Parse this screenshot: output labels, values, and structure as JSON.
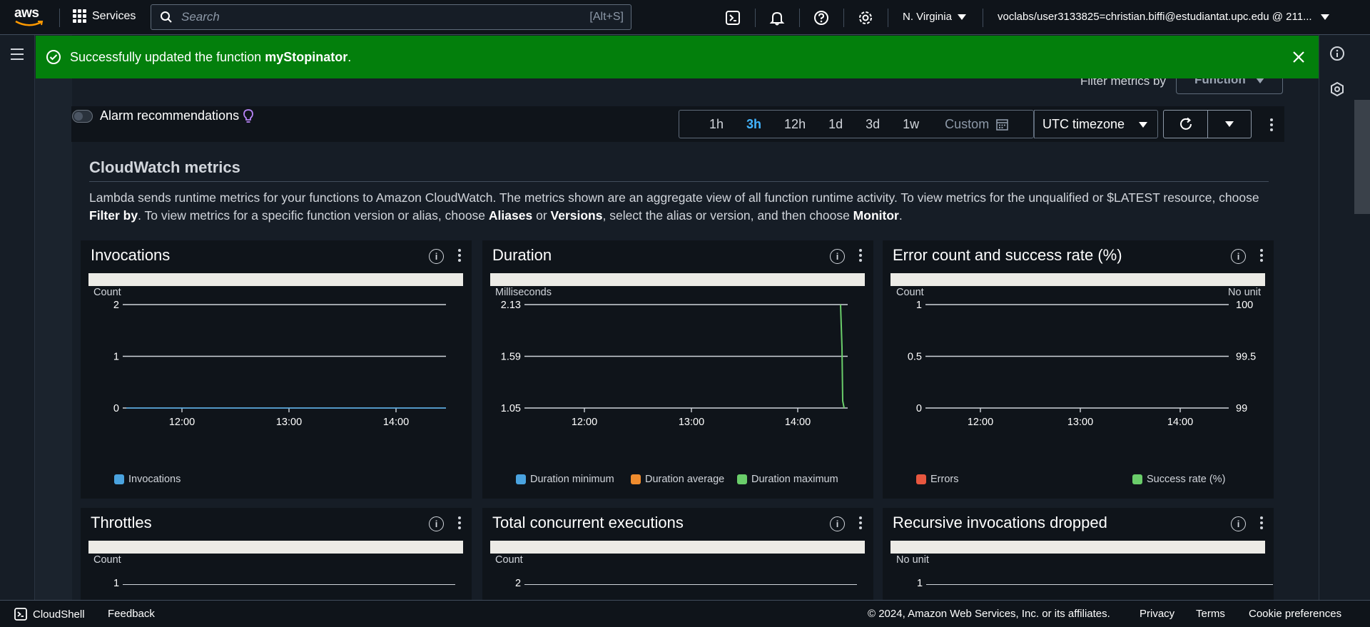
{
  "nav": {
    "logo": "aws",
    "services_label": "Services",
    "search_placeholder": "Search",
    "search_shortcut": "[Alt+S]",
    "region": "N. Virginia",
    "account": "voclabs/user3133825=christian.biffi@estudiantat.upc.edu @ 211...",
    "icons": [
      "cloudshell-icon",
      "notifications-bell-icon",
      "help-icon",
      "settings-gear-icon"
    ]
  },
  "flash": {
    "prefix": "Successfully updated the function ",
    "function_name": "myStopinator",
    "suffix": ".",
    "color": "#037f0c"
  },
  "filter": {
    "label": "Filter metrics by",
    "value": "Function"
  },
  "toolbar": {
    "alarm_recommendations": "Alarm recommendations",
    "time_ranges": [
      "1h",
      "3h",
      "12h",
      "1d",
      "3d",
      "1w"
    ],
    "active_range": "3h",
    "custom_label": "Custom",
    "timezone": "UTC timezone"
  },
  "cloudwatch": {
    "title": "CloudWatch metrics",
    "desc_1": "Lambda sends runtime metrics for your functions to Amazon CloudWatch. The metrics shown are an aggregate view of all function runtime activity. To view metrics for the unqualified or $LATEST resource, choose ",
    "desc_filter_by": "Filter by",
    "desc_2": ". To view metrics for a specific function version or alias, choose ",
    "desc_aliases": "Aliases",
    "desc_or": " or ",
    "desc_versions": "Versions",
    "desc_3": ", select the alias or version, and then choose ",
    "desc_monitor": "Monitor",
    "desc_end": "."
  },
  "widgets": {
    "invocations": {
      "title": "Invocations",
      "unit": "Count",
      "legend": [
        "Invocations"
      ]
    },
    "duration": {
      "title": "Duration",
      "unit": "Milliseconds",
      "legend": [
        "Duration minimum",
        "Duration average",
        "Duration maximum"
      ]
    },
    "errors": {
      "title": "Error count and success rate (%)",
      "unit_left": "Count",
      "unit_right": "No unit",
      "legend": [
        "Errors",
        "Success rate (%)"
      ]
    },
    "throttles": {
      "title": "Throttles",
      "unit": "Count",
      "tick": "1"
    },
    "concurrent": {
      "title": "Total concurrent executions",
      "unit": "Count",
      "tick": "2"
    },
    "recursive": {
      "title": "Recursive invocations dropped",
      "unit": "No unit",
      "tick": "1"
    }
  },
  "chart_data": [
    {
      "type": "line",
      "id": "invocations",
      "x_ticks": [
        "12:00",
        "13:00",
        "14:00"
      ],
      "y_ticks": [
        "0",
        "1",
        "2"
      ],
      "ylim": [
        0,
        2
      ],
      "series": [
        {
          "name": "Invocations",
          "color": "#4aa3df",
          "values": [
            0,
            0
          ]
        }
      ]
    },
    {
      "type": "line",
      "id": "duration",
      "x_ticks": [
        "12:00",
        "13:00",
        "14:00"
      ],
      "y_ticks": [
        "1.05",
        "1.59",
        "2.13"
      ],
      "ylim": [
        1.05,
        2.13
      ],
      "series": [
        {
          "name": "Duration minimum",
          "color": "#4aa3df"
        },
        {
          "name": "Duration average",
          "color": "#f08c2e"
        },
        {
          "name": "Duration maximum",
          "color": "#6acd6a",
          "values": [
            2.13,
            1.05
          ]
        }
      ]
    },
    {
      "type": "line",
      "id": "errors",
      "x_ticks": [
        "12:00",
        "13:00",
        "14:00"
      ],
      "y_ticks": [
        "0",
        "0.5",
        "1"
      ],
      "y2_ticks": [
        "99",
        "99.5",
        "100"
      ],
      "ylim": [
        0,
        1
      ],
      "y2lim": [
        99,
        100
      ],
      "series": [
        {
          "name": "Errors",
          "color": "#e8573f"
        },
        {
          "name": "Success rate (%)",
          "color": "#6acd6a"
        }
      ]
    }
  ]
}
